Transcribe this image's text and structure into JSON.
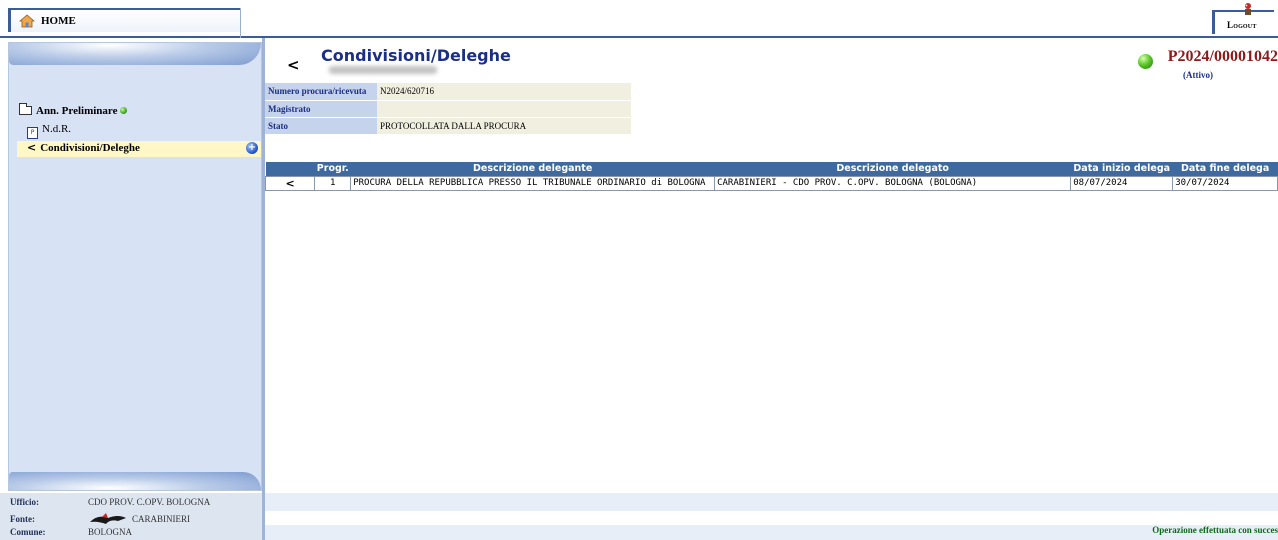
{
  "header": {
    "home_label": "HOME",
    "logout_label": "Logout"
  },
  "sidebar": {
    "root_label": "Ann. Preliminare",
    "items": [
      {
        "label": "N.d.R.",
        "icon": "pdf-doc-icon"
      },
      {
        "label": "Condivisioni/Deleghe",
        "icon": "share-icon",
        "selected": true
      }
    ],
    "add_icon": "plus-circle-icon"
  },
  "footer": {
    "ufficio_label": "Ufficio:",
    "ufficio_value": "CDO PROV. C.OPV. BOLOGNA",
    "fonte_label": "Fonte:",
    "fonte_value": "CARABINIERI",
    "comune_label": "Comune:",
    "comune_value": "BOLOGNA",
    "message": "Operazione effettuata con succes"
  },
  "main": {
    "title": "Condivisioni/Deleghe",
    "procedure_code": "P2024/00001042",
    "procedure_status": "(Attivo)",
    "status_color": "#3aa81c",
    "info": [
      {
        "key": "Numero procura/ricevuta",
        "value": "N2024/620716"
      },
      {
        "key": "Magistrato",
        "value": ""
      },
      {
        "key": "Stato",
        "value": "PROTOCOLLATA DALLA PROCURA"
      }
    ],
    "table": {
      "headers": [
        "",
        "Progr.",
        "Descrizione delegante",
        "Descrizione delegato",
        "Data inizio delega",
        "Data fine delega"
      ],
      "rows": [
        {
          "progr": "1",
          "delegante": "PROCURA DELLA REPUBBLICA PRESSO IL TRIBUNALE ORDINARIO di BOLOGNA",
          "delegato": "CARABINIERI - CDO PROV. C.OPV. BOLOGNA (BOLOGNA)",
          "inizio": "08/07/2024",
          "fine": "30/07/2024"
        }
      ]
    }
  },
  "colors": {
    "accent": "#1b2f86",
    "header_row": "#3f6aa0",
    "procedure_code": "#8b1a1a",
    "success": "#0d6a1b"
  }
}
